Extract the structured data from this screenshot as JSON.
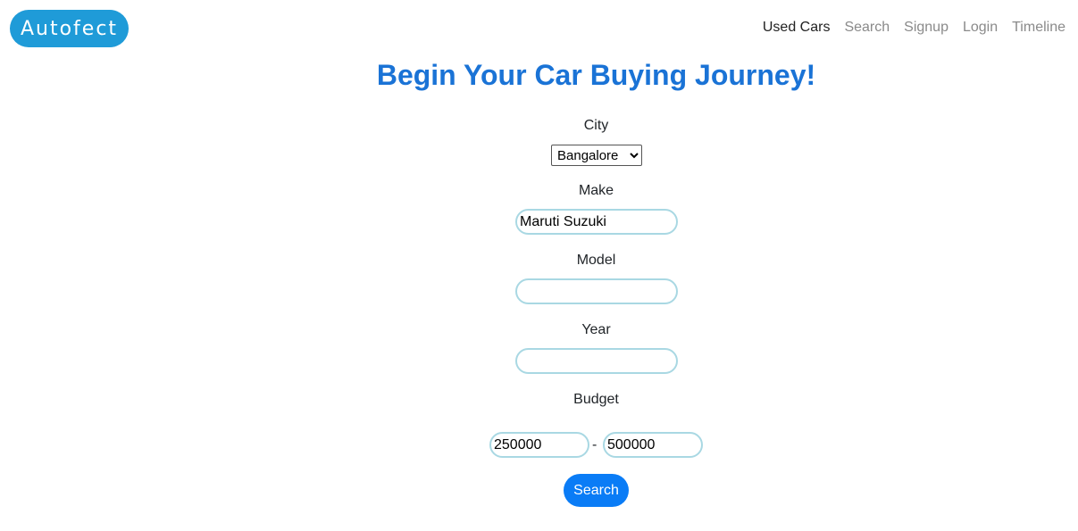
{
  "brand": {
    "logo_text": "Autofect",
    "logo_color": "#1f9bd8"
  },
  "nav": {
    "items": [
      {
        "label": "Used Cars",
        "active": true
      },
      {
        "label": "Search",
        "active": false
      },
      {
        "label": "Signup",
        "active": false
      },
      {
        "label": "Login",
        "active": false
      },
      {
        "label": "Timeline",
        "active": false
      }
    ]
  },
  "main": {
    "heading": "Begin Your Car Buying Journey!",
    "heading_color": "#1a73d6"
  },
  "form": {
    "city": {
      "label": "City",
      "selected": "Bangalore"
    },
    "make": {
      "label": "Make",
      "value": "Maruti Suzuki"
    },
    "model": {
      "label": "Model",
      "value": ""
    },
    "year": {
      "label": "Year",
      "value": ""
    },
    "budget": {
      "label": "Budget",
      "min": "250000",
      "separator": "-",
      "max": "500000"
    },
    "submit_label": "Search",
    "submit_color": "#0a7cf6"
  }
}
